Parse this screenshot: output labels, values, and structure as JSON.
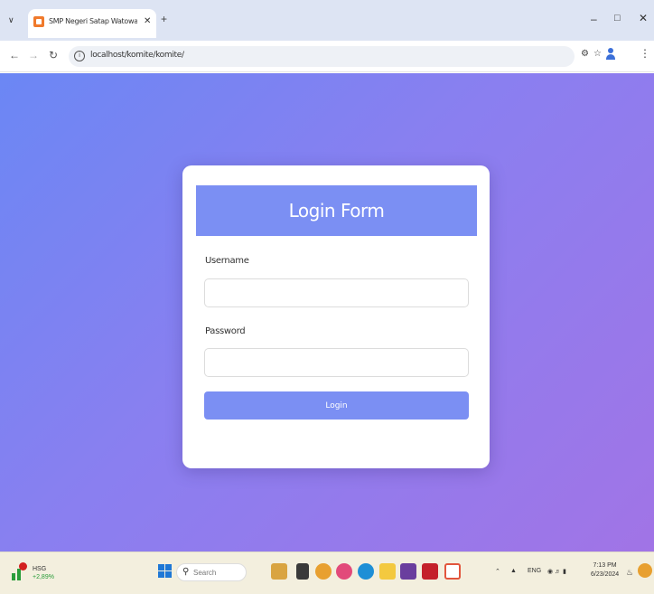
{
  "browser": {
    "tab_title": "SMP Negeri Satap Watowai Ivi.",
    "url": "localhost/komite/komite/",
    "tab_menu_icon": "chevron-down-icon",
    "new_tab": "+",
    "close": "✕"
  },
  "form": {
    "title": "Login Form",
    "username_label": "Username",
    "username_value": "",
    "password_label": "Password",
    "password_value": "",
    "submit_label": "Login"
  },
  "taskbar": {
    "network_type": "HSG",
    "network_change": "+2,89%",
    "search_placeholder": "Search",
    "language": "ENG",
    "time": "7:13 PM",
    "date": "6/23/2024"
  },
  "colors": {
    "accent": "#7b8ff3",
    "bg_gradient_start": "#6b87f4",
    "bg_gradient_end": "#a174e6"
  }
}
